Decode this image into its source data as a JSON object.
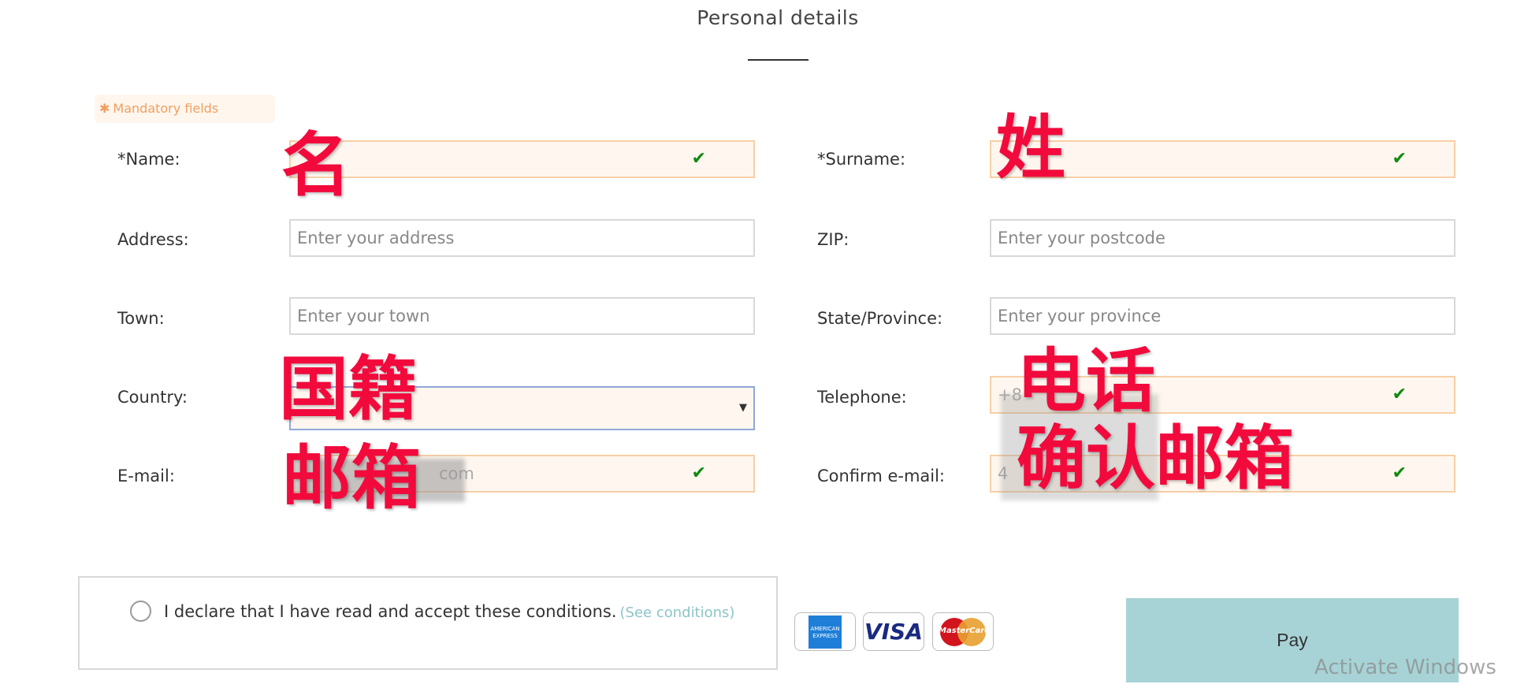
{
  "header": {
    "title": "Personal details"
  },
  "mandatory": {
    "icon": "asterisk-icon",
    "label": "Mandatory fields"
  },
  "form": {
    "name": {
      "label": "*Name:",
      "value": ""
    },
    "surname": {
      "label": "*Surname:",
      "value": ""
    },
    "address": {
      "label": "Address:",
      "placeholder": "Enter your address"
    },
    "zip": {
      "label": "ZIP:",
      "placeholder": "Enter your postcode"
    },
    "town": {
      "label": "Town:",
      "placeholder": "Enter your town"
    },
    "state": {
      "label": "State/Province:",
      "placeholder": "Enter your province"
    },
    "country": {
      "label": "Country:",
      "value": ""
    },
    "telephone": {
      "label": "Telephone:",
      "value": "+8"
    },
    "email": {
      "label": "E-mail:",
      "value": "com"
    },
    "confirm_email": {
      "label": "Confirm e-mail:",
      "value": "4"
    }
  },
  "annotations": {
    "name": "名",
    "surname": "姓",
    "country": "国籍",
    "email": "邮箱",
    "telephone": "电话",
    "confirm_email": "确认邮箱"
  },
  "conditions": {
    "text": "I declare that I have read and accept these conditions.",
    "link": "(See conditions)"
  },
  "cards": {
    "amex_line1": "AMERICAN",
    "amex_line2": "EXPRESS",
    "visa": "VISA",
    "mastercard": "MasterCard"
  },
  "pay": {
    "label": "Pay"
  },
  "watermark": "Activate Windows",
  "colors": {
    "accent": "#a7d3d6",
    "mandatory": "#f0a060",
    "valid": "#108a10",
    "annotation": "#f20a3c"
  }
}
